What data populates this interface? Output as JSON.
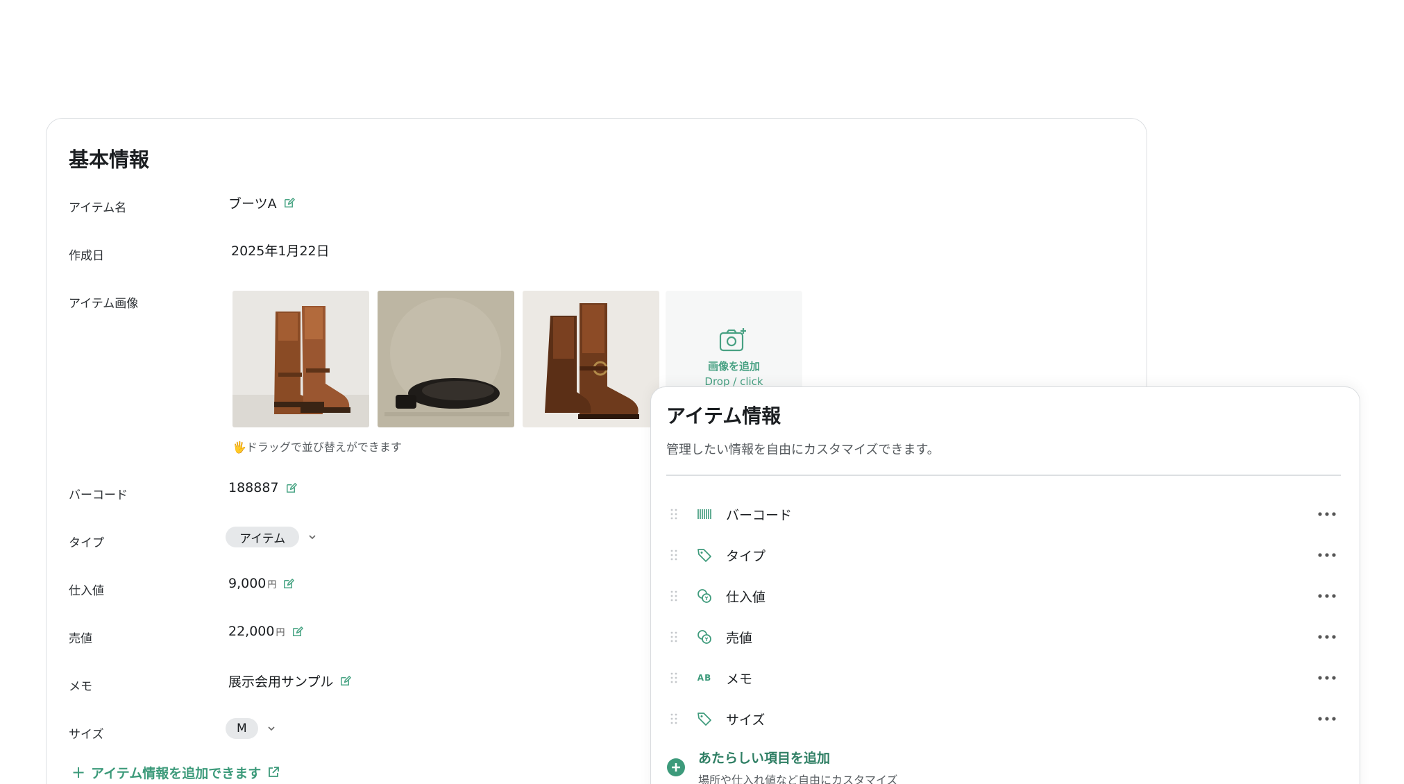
{
  "basic_info": {
    "title": "基本情報",
    "rows": {
      "item_name": {
        "label": "アイテム名",
        "value": "ブーツA"
      },
      "created": {
        "label": "作成日",
        "value": "2025年1月22日"
      },
      "images": {
        "label": "アイテム画像"
      },
      "barcode": {
        "label": "バーコード",
        "value": "188887"
      },
      "type": {
        "label": "タイプ",
        "value": "アイテム"
      },
      "cost": {
        "label": "仕入値",
        "value": "9,000",
        "unit": "円"
      },
      "price": {
        "label": "売値",
        "value": "22,000",
        "unit": "円"
      },
      "memo": {
        "label": "メモ",
        "value": "展示会用サンプル"
      },
      "size": {
        "label": "サイズ",
        "value": "M"
      }
    },
    "image_add": {
      "label": "画像を追加",
      "hint": "Drop / click"
    },
    "drag_hint": "🖐ドラッグで並び替えができます",
    "add_link": "アイテム情報を追加できます"
  },
  "item_panel": {
    "title": "アイテム情報",
    "subtitle": "管理したい情報を自由にカスタマイズできます。",
    "fields": [
      {
        "label": "バーコード",
        "icon": "barcode-icon"
      },
      {
        "label": "タイプ",
        "icon": "tag-icon"
      },
      {
        "label": "仕入値",
        "icon": "coins-icon"
      },
      {
        "label": "売値",
        "icon": "coins-icon"
      },
      {
        "label": "メモ",
        "icon": "text-ab-icon",
        "icon_text": "AB"
      },
      {
        "label": "サイズ",
        "icon": "tag-icon"
      }
    ],
    "new_field": {
      "title": "あたらしい項目を追加",
      "subtitle": "場所や仕入れ値など自由にカスタマイズ"
    }
  },
  "colors": {
    "accent": "#3d9a7b",
    "pill_bg": "#e6e8ea",
    "border": "#dcdfe2"
  }
}
